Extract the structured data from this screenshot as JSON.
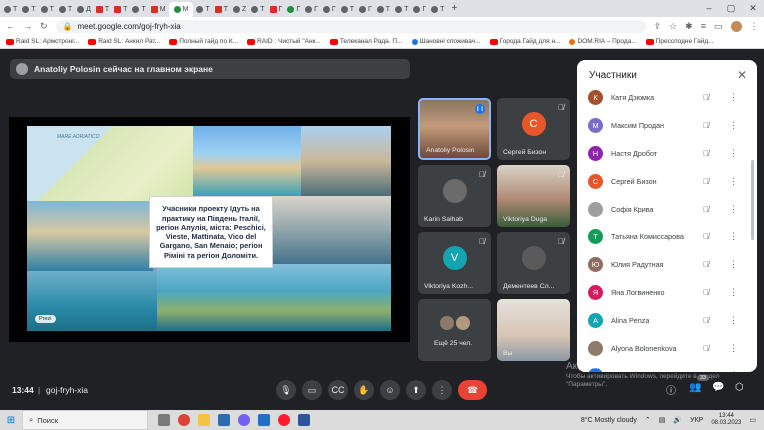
{
  "browser": {
    "tabs": [
      {
        "label": "T",
        "fav": "google"
      },
      {
        "label": "T",
        "fav": "google"
      },
      {
        "label": "T",
        "fav": "google"
      },
      {
        "label": "T",
        "fav": "google"
      },
      {
        "label": "Д",
        "fav": "google"
      },
      {
        "label": "T",
        "fav": "yt"
      },
      {
        "label": "T",
        "fav": "yt"
      },
      {
        "label": "T",
        "fav": "google"
      },
      {
        "label": "M",
        "fav": "gmail"
      },
      {
        "label": "M",
        "fav": "meet",
        "active": true
      },
      {
        "label": "T",
        "fav": "google"
      },
      {
        "label": "T",
        "fav": "yt"
      },
      {
        "label": "Z",
        "fav": "google"
      },
      {
        "label": "T",
        "fav": "google"
      },
      {
        "label": "Г",
        "fav": "yt"
      },
      {
        "label": "Г",
        "fav": "shield"
      },
      {
        "label": "Г",
        "fav": "google"
      },
      {
        "label": "Г",
        "fav": "google"
      },
      {
        "label": "T",
        "fav": "google"
      },
      {
        "label": "Г",
        "fav": "google"
      },
      {
        "label": "T",
        "fav": "google"
      },
      {
        "label": "T",
        "fav": "google"
      },
      {
        "label": "Г",
        "fav": "google"
      },
      {
        "label": "T",
        "fav": "google"
      }
    ],
    "new_tab": "+",
    "url": "meet.google.com/goj-fryh-xia",
    "bookmarks": [
      {
        "label": "Raid SL: Армстронг...",
        "icon": "yt"
      },
      {
        "label": "Raid SL: Анкил Рат...",
        "icon": "yt"
      },
      {
        "label": "Полный гайд по К...",
        "icon": "yt"
      },
      {
        "label": "RAID : Чистый \"Анк...",
        "icon": "yt"
      },
      {
        "label": "Телеканал Рада. П...",
        "icon": "yt"
      },
      {
        "label": "Шановні споживач...",
        "icon": "globe"
      },
      {
        "label": "Города Гайд для н...",
        "icon": "yt"
      },
      {
        "label": "DOM.RIA – Прода...",
        "icon": "star"
      },
      {
        "label": "Прессподне Гайд...",
        "icon": "yt"
      }
    ]
  },
  "meet": {
    "presenter_text": "Anatoliy Polosin сейчас на главном экране",
    "slide": {
      "map_label": "MARE ADRIATICO",
      "caption": "Учасники проекту їдуть на практику на Південь Італії, регіон Апулія, міста: Peschici, Vieste, Mattinata, Vico del Gargano, San Menaio; регіон Ріміні та регіон Доломіти.",
      "badge": "Prezi"
    },
    "tiles": {
      "anatoliy": {
        "name": "Anatoliy Polosin"
      },
      "sergey": {
        "name": "Сергей Бизон",
        "initial": "С",
        "color": "#e8572a"
      },
      "karin": {
        "name": "Karin Salhab"
      },
      "viktoriya_d": {
        "name": "Viktoriya Duga"
      },
      "viktoriya_k": {
        "name": "Viktoriya Kozh...",
        "initial": "V",
        "color": "#12a4af"
      },
      "dementeev": {
        "name": "Дементеев Сл..."
      },
      "more": {
        "name": "Ещё 25 чел."
      },
      "vy": {
        "name": "Вы"
      }
    },
    "participants_title": "Участники",
    "participants": [
      {
        "name": "Катя Дзюмка",
        "initial": "К",
        "color": "#a0522d"
      },
      {
        "name": "Максим Продан",
        "initial": "М",
        "color": "#7c6ec4"
      },
      {
        "name": "Настя Дробот",
        "initial": "Н",
        "color": "#8e24aa"
      },
      {
        "name": "Сергей Бизон",
        "initial": "С",
        "color": "#e8572a"
      },
      {
        "name": "Софія Крива",
        "initial": "",
        "color": "#9e9e9e"
      },
      {
        "name": "Татьяна Комиссарова",
        "initial": "Т",
        "color": "#0f9d58"
      },
      {
        "name": "Юлия Радутная",
        "initial": "Ю",
        "color": "#8d6e63"
      },
      {
        "name": "Яна Логвиненко",
        "initial": "Я",
        "color": "#d81b60"
      },
      {
        "name": "Alina Penza",
        "initial": "A",
        "color": "#12a4af"
      },
      {
        "name": "Alyona Bolonenkova",
        "initial": "",
        "color": "#8d7a6a"
      },
      {
        "name": "",
        "initial": "",
        "color": "#1a73e8"
      }
    ],
    "watermark_title": "Активация Windows",
    "watermark_text": "Чтобы активировать Windows, перейдите в раздел \"Параметры\".",
    "clock": "13:44",
    "separator": "|",
    "meeting_code": "goj-fryh-xia",
    "people_count": "33"
  },
  "taskbar": {
    "search_label": "Поиск",
    "weather": "8°C  Mostly cloudy",
    "lang": "УКР",
    "time": "13:44",
    "date": "08.03.2023"
  }
}
